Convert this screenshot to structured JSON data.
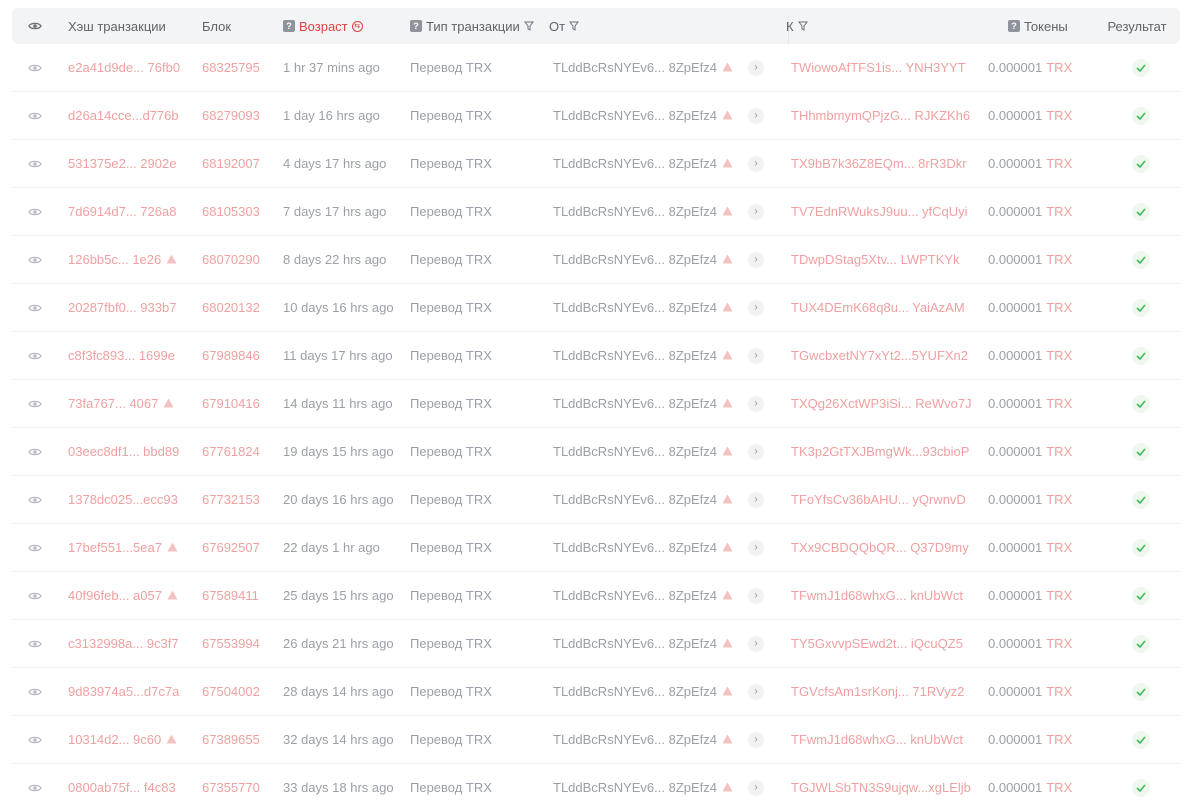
{
  "header": {
    "hash": "Хэш транзакции",
    "block": "Блок",
    "age": "Возраст",
    "type": "Тип транзакции",
    "from": "От",
    "to": "К",
    "tokens": "Токены",
    "result": "Результат"
  },
  "colors": {
    "link": "#f0a0a0",
    "accent": "#e0413f",
    "success": "#3ebd5a"
  },
  "rows": [
    {
      "hash": "e2a41d9de... 76fb0",
      "hash_warn": false,
      "block": "68325795",
      "age": "1 hr 37 mins ago",
      "type": "Перевод TRX",
      "from": "TLddBcRsNYEv6... 8ZpEfz4",
      "to": "TWiowoAfTFS1is... YNH3YYT",
      "amount": "0.000001",
      "token": "TRX"
    },
    {
      "hash": "d26a14cce...d776b",
      "hash_warn": false,
      "block": "68279093",
      "age": "1 day 16 hrs ago",
      "type": "Перевод TRX",
      "from": "TLddBcRsNYEv6... 8ZpEfz4",
      "to": "THhmbmymQPjzG... RJKZKh6",
      "amount": "0.000001",
      "token": "TRX"
    },
    {
      "hash": "531375e2... 2902e",
      "hash_warn": false,
      "block": "68192007",
      "age": "4 days 17 hrs ago",
      "type": "Перевод TRX",
      "from": "TLddBcRsNYEv6... 8ZpEfz4",
      "to": "TX9bB7k36Z8EQm... 8rR3Dkr",
      "amount": "0.000001",
      "token": "TRX"
    },
    {
      "hash": "7d6914d7... 726a8",
      "hash_warn": false,
      "block": "68105303",
      "age": "7 days 17 hrs ago",
      "type": "Перевод TRX",
      "from": "TLddBcRsNYEv6... 8ZpEfz4",
      "to": "TV7EdnRWuksJ9uu... yfCqUyi",
      "amount": "0.000001",
      "token": "TRX"
    },
    {
      "hash": "126bb5c... 1e26",
      "hash_warn": true,
      "block": "68070290",
      "age": "8 days 22 hrs ago",
      "type": "Перевод TRX",
      "from": "TLddBcRsNYEv6... 8ZpEfz4",
      "to": "TDwpDStag5Xtv... LWPTKYk",
      "amount": "0.000001",
      "token": "TRX"
    },
    {
      "hash": "20287fbf0... 933b7",
      "hash_warn": false,
      "block": "68020132",
      "age": "10 days 16 hrs ago",
      "type": "Перевод TRX",
      "from": "TLddBcRsNYEv6... 8ZpEfz4",
      "to": "TUX4DEmK68q8u... YaiAzAM",
      "amount": "0.000001",
      "token": "TRX"
    },
    {
      "hash": "c8f3fc893... 1699e",
      "hash_warn": false,
      "block": "67989846",
      "age": "11 days 17 hrs ago",
      "type": "Перевод TRX",
      "from": "TLddBcRsNYEv6... 8ZpEfz4",
      "to": "TGwcbxetNY7xYt2...5YUFXn2",
      "amount": "0.000001",
      "token": "TRX"
    },
    {
      "hash": "73fa767... 4067",
      "hash_warn": true,
      "block": "67910416",
      "age": "14 days 11 hrs ago",
      "type": "Перевод TRX",
      "from": "TLddBcRsNYEv6... 8ZpEfz4",
      "to": "TXQg26XctWP3iSi... ReWvo7J",
      "amount": "0.000001",
      "token": "TRX"
    },
    {
      "hash": "03eec8df1... bbd89",
      "hash_warn": false,
      "block": "67761824",
      "age": "19 days 15 hrs ago",
      "type": "Перевод TRX",
      "from": "TLddBcRsNYEv6... 8ZpEfz4",
      "to": "TK3p2GtTXJBmgWk...93cbioP",
      "amount": "0.000001",
      "token": "TRX"
    },
    {
      "hash": "1378dc025...ecc93",
      "hash_warn": false,
      "block": "67732153",
      "age": "20 days 16 hrs ago",
      "type": "Перевод TRX",
      "from": "TLddBcRsNYEv6... 8ZpEfz4",
      "to": "TFoYfsCv36bAHU... yQrwnvD",
      "amount": "0.000001",
      "token": "TRX"
    },
    {
      "hash": "17bef551...5ea7",
      "hash_warn": true,
      "block": "67692507",
      "age": "22 days 1 hr ago",
      "type": "Перевод TRX",
      "from": "TLddBcRsNYEv6... 8ZpEfz4",
      "to": "TXx9CBDQQbQR... Q37D9my",
      "amount": "0.000001",
      "token": "TRX"
    },
    {
      "hash": "40f96feb... a057",
      "hash_warn": true,
      "block": "67589411",
      "age": "25 days 15 hrs ago",
      "type": "Перевод TRX",
      "from": "TLddBcRsNYEv6... 8ZpEfz4",
      "to": "TFwmJ1d68whxG... knUbWct",
      "amount": "0.000001",
      "token": "TRX"
    },
    {
      "hash": "c3132998a... 9c3f7",
      "hash_warn": false,
      "block": "67553994",
      "age": "26 days 21 hrs ago",
      "type": "Перевод TRX",
      "from": "TLddBcRsNYEv6... 8ZpEfz4",
      "to": "TY5GxvvpSEwd2t... iQcuQZ5",
      "amount": "0.000001",
      "token": "TRX"
    },
    {
      "hash": "9d83974a5...d7c7a",
      "hash_warn": false,
      "block": "67504002",
      "age": "28 days 14 hrs ago",
      "type": "Перевод TRX",
      "from": "TLddBcRsNYEv6... 8ZpEfz4",
      "to": "TGVcfsAm1srKonj... 71RVyz2",
      "amount": "0.000001",
      "token": "TRX"
    },
    {
      "hash": "10314d2... 9c60",
      "hash_warn": true,
      "block": "67389655",
      "age": "32 days 14 hrs ago",
      "type": "Перевод TRX",
      "from": "TLddBcRsNYEv6... 8ZpEfz4",
      "to": "TFwmJ1d68whxG... knUbWct",
      "amount": "0.000001",
      "token": "TRX"
    },
    {
      "hash": "0800ab75f... f4c83",
      "hash_warn": false,
      "block": "67355770",
      "age": "33 days 18 hrs ago",
      "type": "Перевод TRX",
      "from": "TLddBcRsNYEv6... 8ZpEfz4",
      "to": "TGJWLSbTN3S9ujqw...xgLEljb",
      "amount": "0.000001",
      "token": "TRX"
    }
  ]
}
